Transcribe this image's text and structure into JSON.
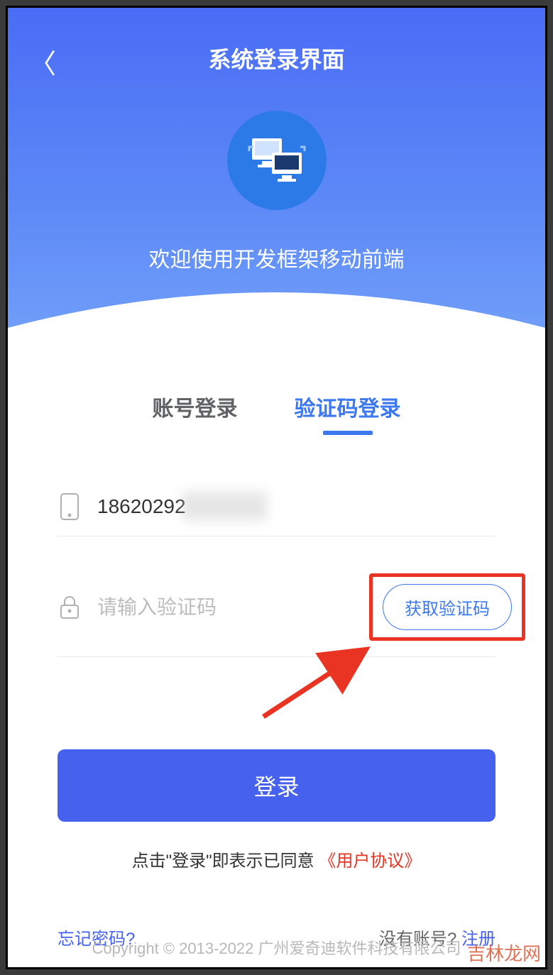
{
  "header": {
    "title": "系统登录界面",
    "welcome": "欢迎使用开发框架移动前端"
  },
  "tabs": {
    "account": "账号登录",
    "sms": "验证码登录"
  },
  "form": {
    "phone_value": "18620292",
    "code_placeholder": "请输入验证码",
    "get_code_label": "获取验证码",
    "login_label": "登录"
  },
  "agreement": {
    "prefix": "点击\"登录\"即表示已同意",
    "link": "《用户协议》"
  },
  "links": {
    "forgot": "忘记密码?",
    "no_account": "没有账号?",
    "register": "注册"
  },
  "footer": {
    "copyright": "Copyright © 2013-2022 广州爱奇迪软件科技有限公司"
  },
  "watermark": "吉林龙网"
}
